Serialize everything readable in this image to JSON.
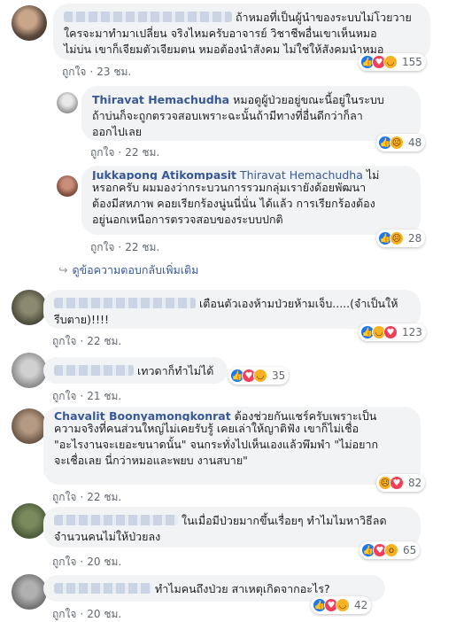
{
  "comments": [
    {
      "name": "",
      "lines": [
        "ถ้าหมอที่เป็นผู้นำของระบบไม่โวยวาย",
        "ใครจะมาทำมาเปลี่ยน จริงไหมครับอาจารย์ วิชาชีพอื่นเขาเห็นหมอ",
        "ไม่บ่น เขาก็เจียมตัวเจียมตน หมอต้องนำสังคม ไม่ใช่ให้สังคมนำหมอ"
      ],
      "like_label": "ถูกใจ",
      "time": "23 ชม.",
      "reaction_count": "155",
      "reaction_icons": [
        "like-icon",
        "love-icon",
        "haha-icon"
      ]
    },
    {
      "name": "Thiravat Hemachudha",
      "lines": [
        "หมอดูผู้ป่วยอยู่ขณะนี้อยู่ในระบบ",
        "ถ้าบ่นก็จะถูกตรวจสอบเพราะฉะนั้นถ้ามีทางที่อื่นดีกว่าก็ลา",
        "ออกไปเลย"
      ],
      "like_label": "ถูกใจ",
      "time": "22 ชม.",
      "reaction_count": "48",
      "reaction_icons": [
        "like-icon",
        "sad-icon"
      ]
    },
    {
      "name": "Jukkapong Atikompasit",
      "tag": "Thiravat Hemachudha",
      "lines": [
        "ไม่",
        "หรอกครับ ผมมองว่ากระบวนการรวมกลุ่มเรายังด้อยพัฒนา",
        "ต้องมีสหภาพ คอยเรียกร้องนู่นนี่นั่น ได้แล้ว การเรียกร้องต้อง",
        "อยู่นอกเหนือการตรวจสอบของระบบปกติ"
      ],
      "like_label": "ถูกใจ",
      "time": "22 ชม.",
      "reaction_count": "28",
      "reaction_icons": [
        "like-icon",
        "sad-icon"
      ]
    },
    {
      "name": "",
      "lines": [
        "เตือนตัวเองห้ามป่วยห้ามเจ็บ.....(จำเป็นให้",
        "รีบตาย)!!!!"
      ],
      "like_label": "ถูกใจ",
      "time": "22 ชม.",
      "reaction_count": "123",
      "reaction_icons": [
        "like-icon",
        "haha-icon",
        "love-icon"
      ]
    },
    {
      "name": "",
      "lines": [
        "เทวดาก็ทำไม่ได้"
      ],
      "like_label": "ถูกใจ",
      "time": "21 ชม.",
      "reaction_count": "35",
      "reaction_icons": [
        "like-icon",
        "love-icon",
        "haha-icon"
      ]
    },
    {
      "name": "Chavalit Boonyamongkonrat",
      "lines": [
        "ต้องช่วยกันแชร์ครับเพราะเป็น",
        "ความจริงที่คนส่วนใหญ่ไม่เคยรับรู้ เคยเล่าให้ญาติฟัง เขาก็ไม่เชื่อ",
        "\"อะไรงานจะเยอะขนาดนั้น\" จนกระทั่งไปเห็นเองแล้วพึมพำ \"ไม่อยาก",
        "จะเชื่อเลย นี่กว่าหมอและพยบ งานสบาย\""
      ],
      "like_label": "ถูกใจ",
      "time": "22 ชม.",
      "reaction_count": "82",
      "reaction_icons": [
        "sad-icon",
        "love-icon"
      ]
    },
    {
      "name": "",
      "lines": [
        "ในเมื่อมีป่วยมากขึ้นเรื่อยๆ ทำไมไมหาวิธีลด",
        "จำนวนคนไม่ให้ป่วยลง"
      ],
      "like_label": "ถูกใจ",
      "time": "20 ชม.",
      "reaction_count": "65",
      "reaction_icons": [
        "like-icon",
        "love-icon",
        "wow-icon"
      ]
    },
    {
      "name": "",
      "lines": [
        "ทำไมคนถึงป่วย สาเหตุเกิดจากอะไร?"
      ],
      "like_label": "ถูกใจ",
      "time": "20 ชม.",
      "reaction_count": "42",
      "reaction_icons": [
        "like-icon",
        "love-icon",
        "haha-icon"
      ]
    }
  ],
  "view_more_replies": "ดูข้อความตอบกลับเพิ่มเติม",
  "colors": {
    "name": "#385898",
    "bubble": "#f2f3f5",
    "meta": "#606770",
    "like": "#1877f2",
    "love": "#f33e58",
    "emoji": "#f7b125"
  }
}
